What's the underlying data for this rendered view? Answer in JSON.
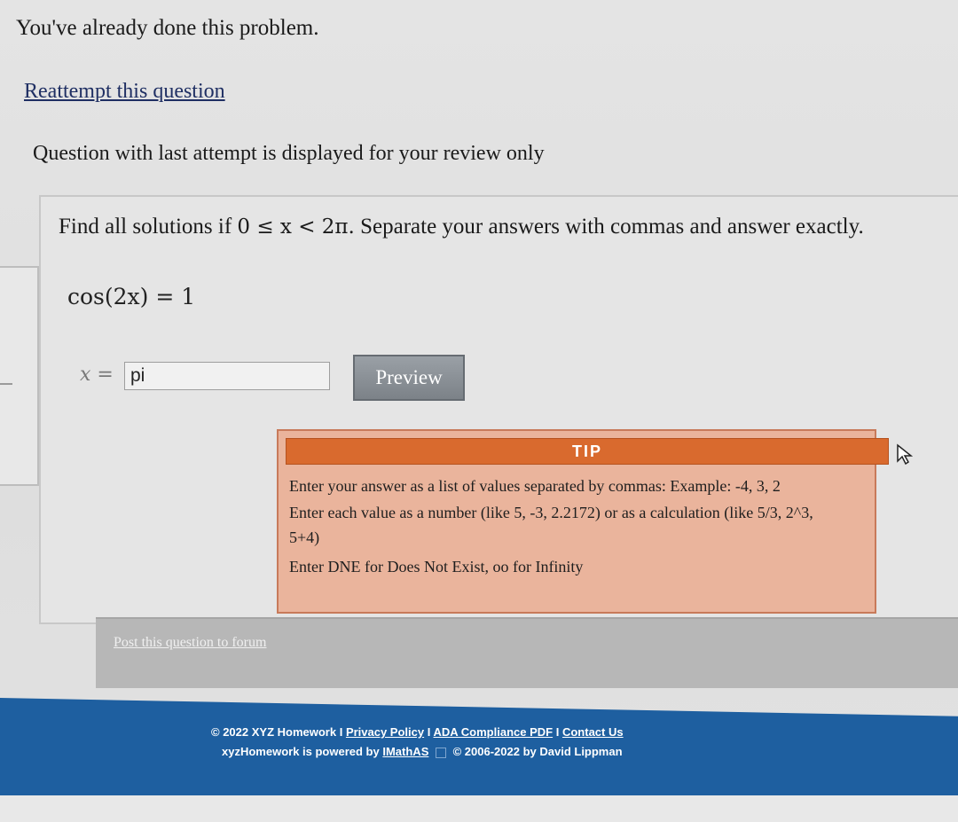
{
  "status": {
    "done_message": "You've already done this problem.",
    "reattempt_link": "Reattempt this question",
    "review_note": "Question with last attempt is displayed for your review only"
  },
  "question": {
    "prompt_prefix": "Find all solutions if",
    "prompt_math": "0 ≤ x < 2π.",
    "prompt_suffix": "Separate your answers with commas and answer exactly.",
    "equation": "cos(2x) = 1",
    "answer_label": "x =",
    "answer_value": "pi",
    "preview_label": "Preview"
  },
  "tip": {
    "header": "TIP",
    "line1": "Enter your answer as a list of values separated by commas: Example: -4, 3, 2",
    "line2": "Enter each value as a number (like 5, -3, 2.2172) or as a calculation (like 5/3, 2^3,",
    "line3": "5+4)",
    "line4": "Enter DNE for Does Not Exist, oo for Infinity"
  },
  "forum": {
    "link": "Post this question to forum"
  },
  "footer": {
    "copyright": "© 2022 XYZ Homework I",
    "privacy": "Privacy Policy",
    "sep1": "I",
    "ada": "ADA Compliance PDF",
    "sep2": "I",
    "contact": "Contact Us",
    "powered_prefix": "xyzHomework is powered by",
    "imathas": "IMathAS",
    "lippman": "© 2006-2022 by David Lippman"
  },
  "colors": {
    "tip_header": "#d96a2e",
    "tip_body": "#eab49c",
    "footer_bg": "#1e5fa0",
    "preview_button": "#8a9096"
  }
}
